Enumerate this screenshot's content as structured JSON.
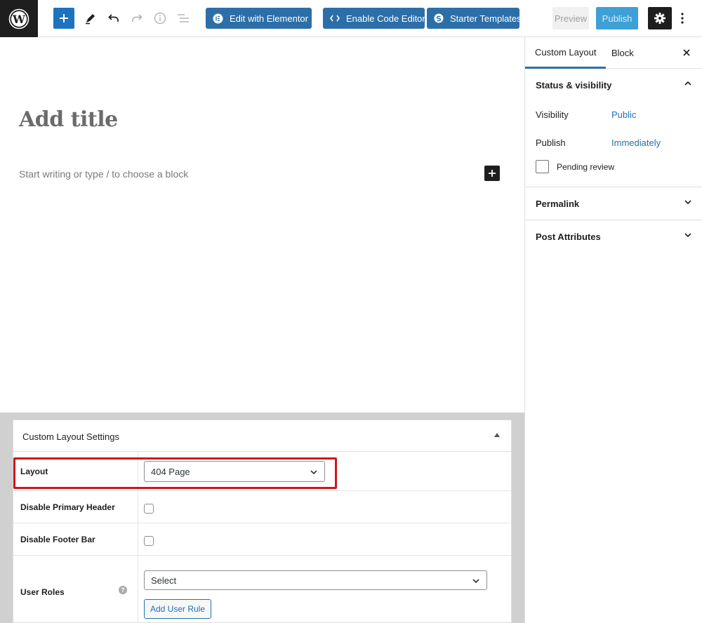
{
  "toolbar": {
    "add_block_icon": "plus-icon",
    "tools_icon": "pencil-icon",
    "undo_icon": "undo-icon",
    "redo_icon": "redo-icon",
    "details_icon": "info-icon",
    "outline_icon": "list-view-icon",
    "edit_elementor_label": "Edit with Elementor",
    "code_editor_label": "Enable Code Editor",
    "starter_templates_label": "Starter Templates",
    "preview_label": "Preview",
    "publish_label": "Publish",
    "accent": "#2c6fa8"
  },
  "editor": {
    "title_placeholder": "Add title",
    "body_placeholder": "Start writing or type / to choose a block"
  },
  "sidebar": {
    "tabs": [
      {
        "label": "Custom Layout",
        "active": true
      },
      {
        "label": "Block",
        "active": false
      }
    ],
    "status": {
      "heading": "Status & visibility",
      "visibility_label": "Visibility",
      "visibility_value": "Public",
      "publish_label": "Publish",
      "publish_value": "Immediately",
      "pending_label": "Pending review"
    },
    "permalink_heading": "Permalink",
    "attributes_heading": "Post Attributes"
  },
  "meta": {
    "title": "Custom Layout Settings",
    "layout_label": "Layout",
    "layout_value": "404 Page",
    "disable_header_label": "Disable Primary Header",
    "disable_footer_label": "Disable Footer Bar",
    "user_roles_label": "User Roles",
    "user_roles_select": "Select",
    "add_rule_label": "Add User Rule"
  }
}
